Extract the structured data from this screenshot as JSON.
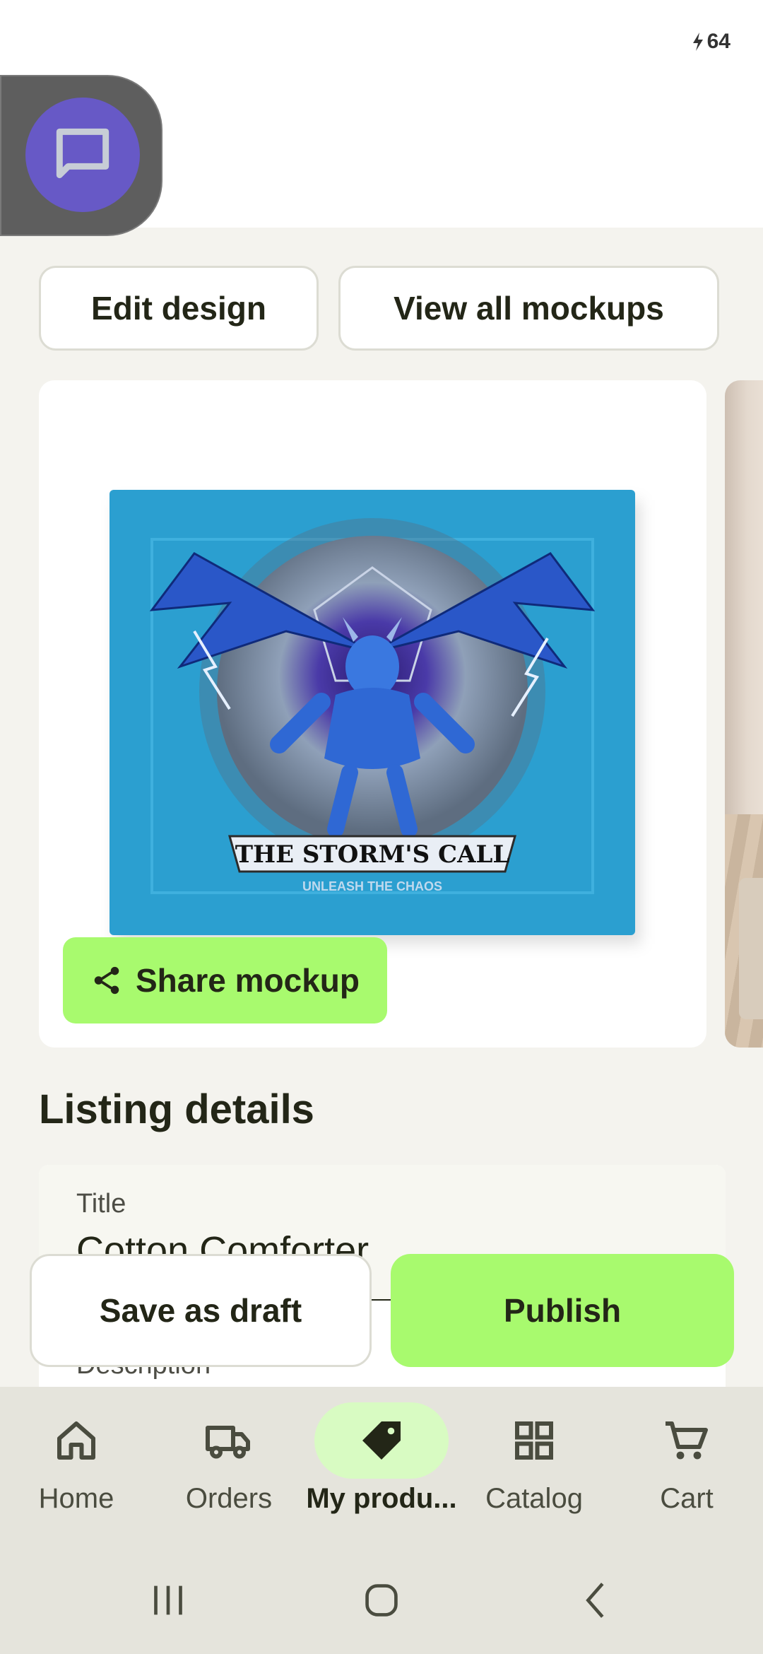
{
  "status": {
    "battery": "64"
  },
  "actions": {
    "edit_design": "Edit design",
    "view_all_mockups": "View all mockups"
  },
  "mockup": {
    "share_label": "Share mockup",
    "product_art_text": [
      "THE STORM'S CALL",
      "UNLEASH THE CHAOS"
    ]
  },
  "listing": {
    "section_title": "Listing details",
    "title_label": "Title",
    "title_value": "Cotton Comforter",
    "description_label": "Description"
  },
  "footer_actions": {
    "save_draft": "Save as draft",
    "publish": "Publish"
  },
  "bottom_nav": {
    "items": [
      {
        "label": "Home",
        "icon": "home-icon"
      },
      {
        "label": "Orders",
        "icon": "truck-icon"
      },
      {
        "label": "My produ...",
        "icon": "tag-icon",
        "active": true
      },
      {
        "label": "Catalog",
        "icon": "grid-icon"
      },
      {
        "label": "Cart",
        "icon": "cart-icon"
      }
    ]
  },
  "colors": {
    "accent": "#a8fa6e",
    "chat_bubble": "#6759c6",
    "comforter": "#2b9fd0"
  }
}
